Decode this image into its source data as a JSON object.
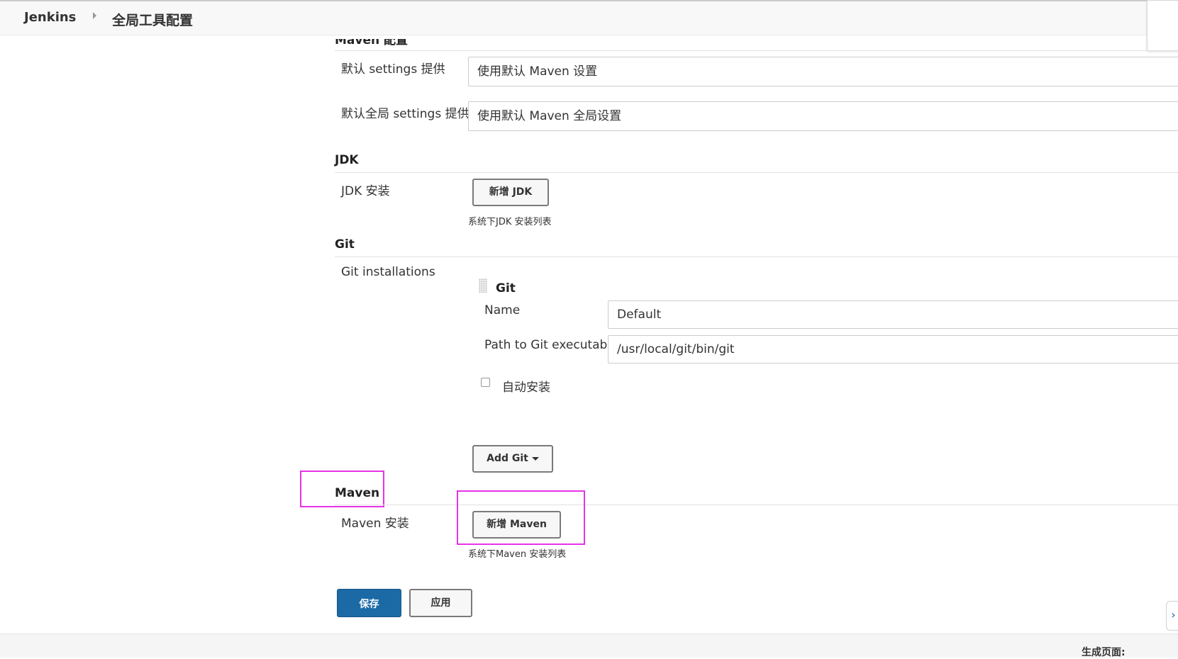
{
  "header": {
    "root": "Jenkins",
    "page": "全局工具配置"
  },
  "maven_config": {
    "title": "Maven 配置",
    "settings_label": "默认 settings 提供",
    "settings_value": "使用默认 Maven 设置",
    "global_settings_label": "默认全局 settings 提供",
    "global_settings_value": "使用默认 Maven 全局设置"
  },
  "jdk": {
    "title": "JDK",
    "install_label": "JDK 安装",
    "add_button": "新增 JDK",
    "hint": "系统下JDK 安装列表"
  },
  "git": {
    "title": "Git",
    "installations_label": "Git installations",
    "item_title": "Git",
    "name_label": "Name",
    "name_value": "Default",
    "path_label": "Path to Git executable",
    "path_value": "/usr/local/git/bin/git",
    "auto_install_label": "自动安装",
    "auto_install_checked": false,
    "add_button": "Add Git"
  },
  "maven": {
    "title": "Maven",
    "install_label": "Maven 安装",
    "add_button": "新增 Maven",
    "hint": "系统下Maven 安装列表"
  },
  "actions": {
    "save": "保存",
    "apply": "应用"
  },
  "footer": {
    "generated": "生成页面:"
  },
  "colors": {
    "primary": "#1b6aa6",
    "highlight": "#e633e6"
  }
}
